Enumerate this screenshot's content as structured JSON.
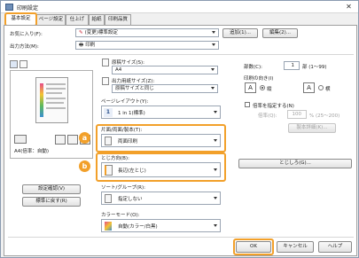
{
  "window": {
    "title": "印刷設定",
    "close": "✕"
  },
  "tabs": [
    "基本設定",
    "ページ設定",
    "仕上げ",
    "給紙",
    "印刷品質"
  ],
  "favorites": {
    "label": "お気に入り(F):",
    "value": "(変更)標準設定",
    "add": "追加(1)...",
    "edit": "編集(2)..."
  },
  "output": {
    "label": "出力方法(M):",
    "value": "印刷"
  },
  "paper_size": {
    "label": "原稿サイズ(S):",
    "value": "A4"
  },
  "output_paper": {
    "label": "出力用紙サイズ(Z):",
    "value": "原稿サイズと同じ"
  },
  "copies": {
    "label": "部数(C):",
    "value": "1",
    "unit": "部 (1～99)"
  },
  "orientation": {
    "label": "印刷の向き(I)",
    "portrait": "縦",
    "landscape": "横",
    "portrait_key": "A",
    "landscape_key": "A"
  },
  "layout": {
    "label": "ページレイアウト(Y):",
    "value": "1 in 1(標準)",
    "num": "1"
  },
  "zoom": {
    "label": "倍率を指定する(N)",
    "scale_label": "倍率(Q):",
    "scale_value": "100",
    "scale_unit": "% (25～200)"
  },
  "duplex": {
    "label": "片面/両面/製本(T):",
    "value": "両面印刷",
    "badge": "a"
  },
  "binding": {
    "label": "とじ方向(B):",
    "value": "長辺(左とじ)",
    "badge": "b",
    "btn": "とじしろ(G)..."
  },
  "binding_detail": {
    "btn": "製本詳細(K)..."
  },
  "sort": {
    "label": "ソート/グループ(R):",
    "value": "指定しない"
  },
  "color": {
    "label": "カラーモード(O):",
    "value": "自動(カラー/白黒)"
  },
  "preview": {
    "caption": "A4(倍率：自動)",
    "settings_btn": "設定確認(V)",
    "default_btn": "標準に戻す(R)"
  },
  "footer": {
    "ok": "OK",
    "cancel": "キャンセル",
    "help": "ヘルプ"
  },
  "colors": {
    "accent": "#f2a02a",
    "panel_border": "#a0a0a0"
  }
}
